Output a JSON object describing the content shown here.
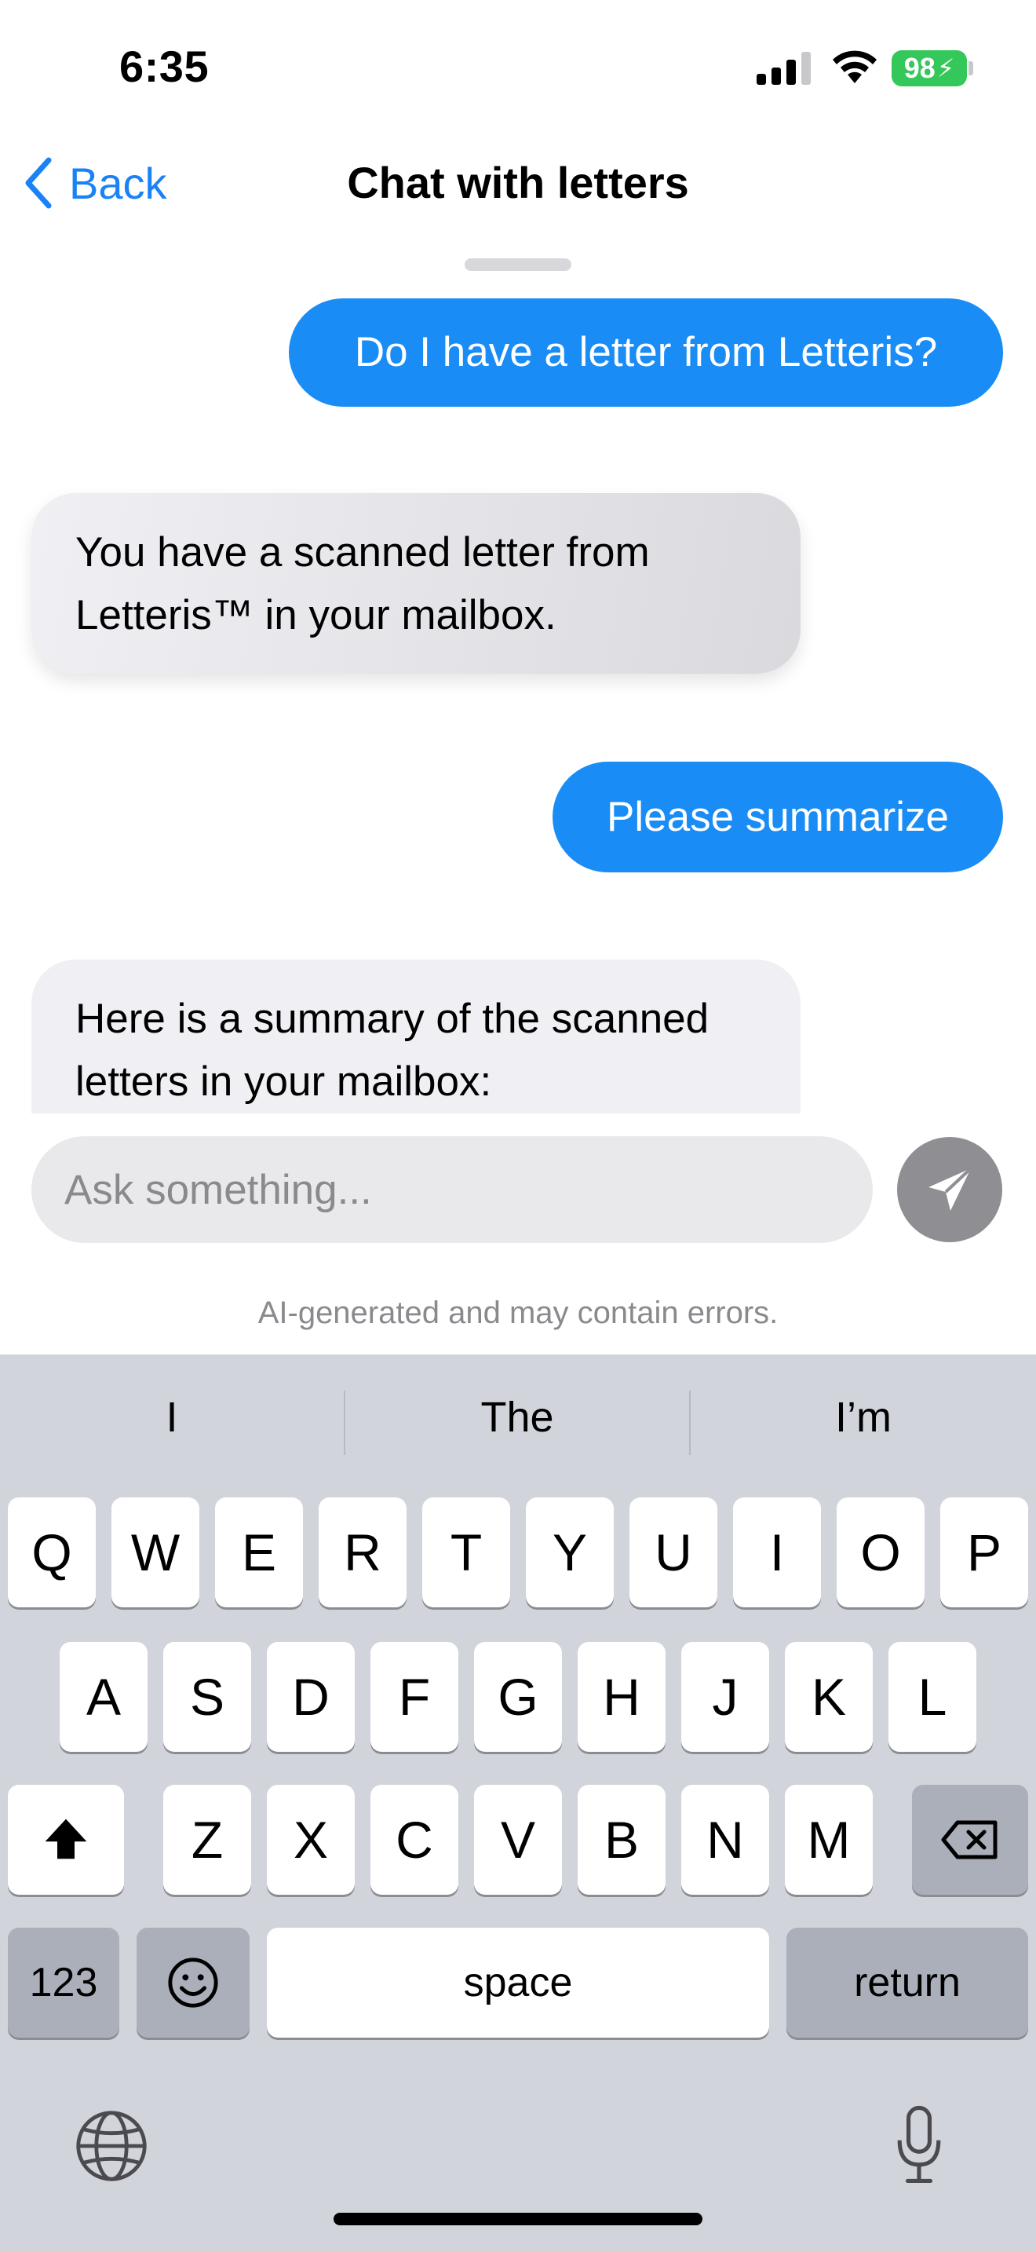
{
  "status_bar": {
    "time": "6:35",
    "battery": "98"
  },
  "nav": {
    "back_label": "Back",
    "title": "Chat with letters"
  },
  "messages": [
    {
      "role": "user",
      "text": "Do I have a letter from Letteris?"
    },
    {
      "role": "assistant",
      "text": "You have a scanned letter from Letteris™ in your mailbox."
    },
    {
      "role": "user",
      "text": "Please summarize"
    },
    {
      "role": "assistant",
      "text": "Here is a summary of the scanned letters in your mailbox:"
    }
  ],
  "composer": {
    "placeholder": "Ask something...",
    "disclaimer": "AI-generated and may contain errors."
  },
  "keyboard": {
    "suggestions": [
      "I",
      "The",
      "I’m"
    ],
    "row1": [
      "Q",
      "W",
      "E",
      "R",
      "T",
      "Y",
      "U",
      "I",
      "O",
      "P"
    ],
    "row2": [
      "A",
      "S",
      "D",
      "F",
      "G",
      "H",
      "J",
      "K",
      "L"
    ],
    "row3": [
      "Z",
      "X",
      "C",
      "V",
      "B",
      "N",
      "M"
    ],
    "numbers_label": "123",
    "space_label": "space",
    "return_label": "return"
  },
  "colors": {
    "accent": "#1a8cf5",
    "battery": "#34c759",
    "keyboard_bg": "#d1d4db"
  }
}
